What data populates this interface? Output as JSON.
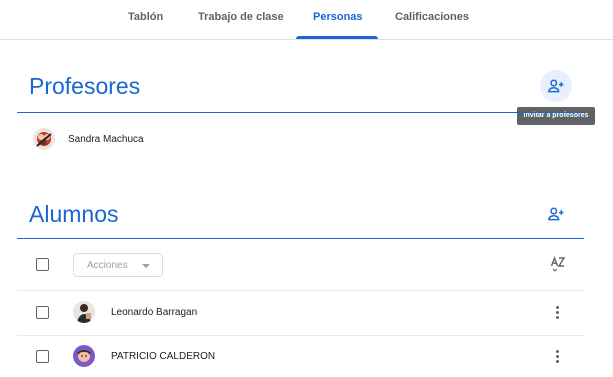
{
  "tabs": [
    {
      "label": "Tablón"
    },
    {
      "label": "Trabajo de clase"
    },
    {
      "label": "Personas",
      "active": true
    },
    {
      "label": "Calificaciones"
    }
  ],
  "teachers": {
    "title": "Profesores",
    "invite_tooltip": "Invitar a profesores",
    "items": [
      {
        "name": "Sandra Machuca"
      }
    ]
  },
  "students": {
    "title": "Alumnos",
    "actions_label": "Acciones",
    "sort_icon": "sort-az-icon",
    "items": [
      {
        "name": "Leonardo Barragan"
      },
      {
        "name": "PATRICIO CALDERON"
      }
    ]
  },
  "colors": {
    "accent": "#1967d2",
    "text": "#202124",
    "muted": "#5f6368",
    "tooltip_bg": "#5f6368"
  }
}
